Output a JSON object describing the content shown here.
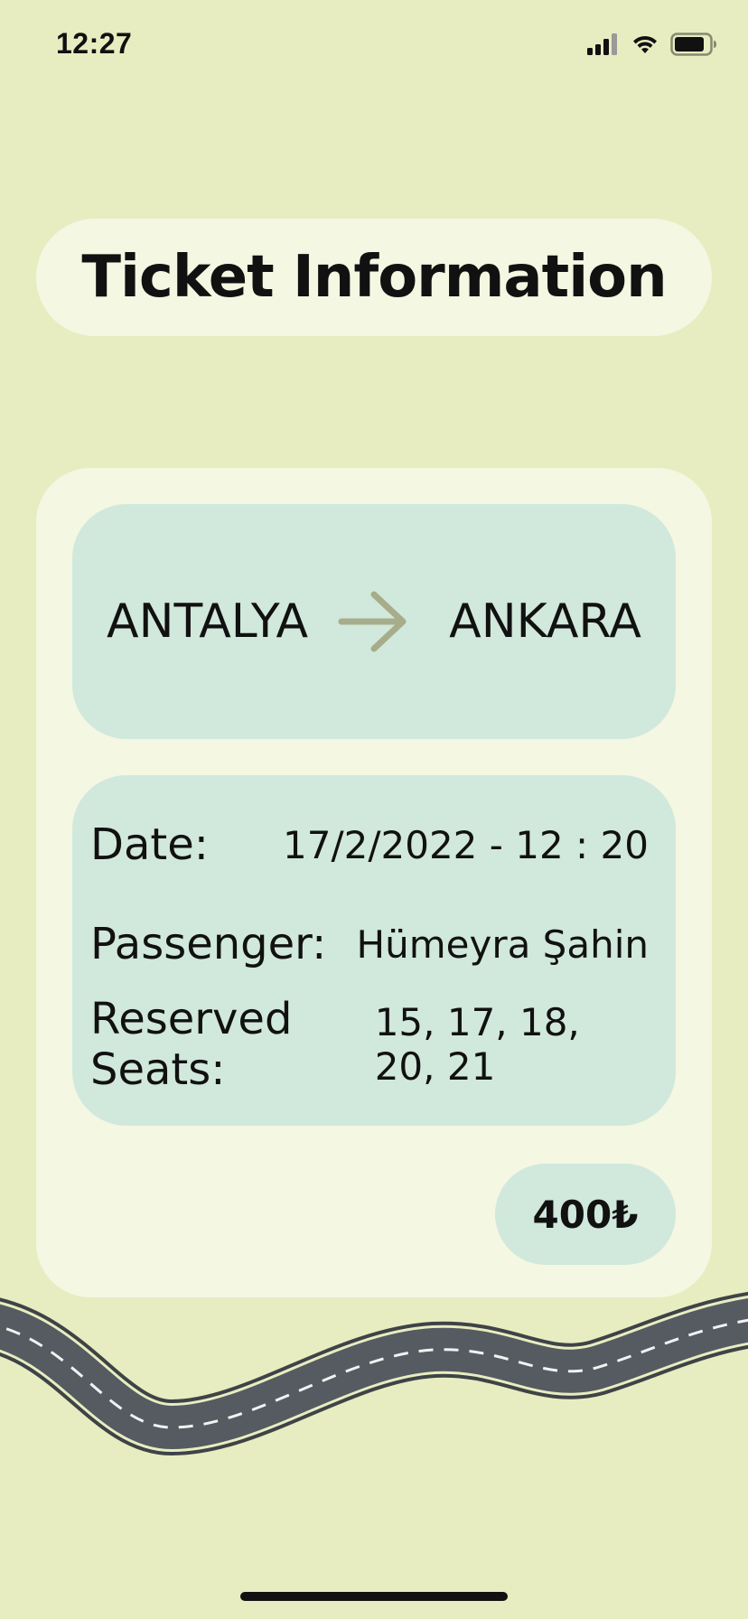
{
  "status_bar": {
    "time": "12:27",
    "icons": [
      "signal-icon",
      "wifi-icon",
      "battery-icon"
    ]
  },
  "header": {
    "title": "Ticket Information"
  },
  "route": {
    "from": "ANTALYA",
    "to": "ANKARA",
    "arrow_icon": "arrow-right-icon"
  },
  "details": {
    "date_label": "Date:",
    "date_value": "17/2/2022 - 12 : 20",
    "passenger_label": "Passenger:",
    "passenger_value": "Hümeyra Şahin",
    "seats_label": "Reserved Seats:",
    "seats_value": "15, 17, 18, 20, 21"
  },
  "price": {
    "value": "400₺"
  },
  "colors": {
    "background": "#e7edc0",
    "card": "#f4f7e2",
    "panel": "#d1e8dc",
    "arrow": "#a7ac8a",
    "road": "#555b61"
  }
}
